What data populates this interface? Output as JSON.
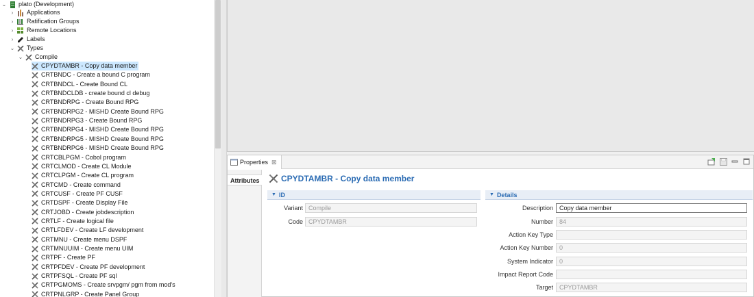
{
  "tree": {
    "root": "plato (Development)",
    "groups": [
      "Applications",
      "Ratification Groups",
      "Remote Locations",
      "Labels",
      "Types"
    ],
    "compile": "Compile",
    "items": [
      "CPYDTAMBR - Copy data member",
      "CRTBNDC - Create a bound C program",
      "CRTBNDCL - Create Bound CL",
      "CRTBNDCLDB - create bound cl debug",
      "CRTBNDRPG - Create Bound RPG",
      "CRTBNDRPG2 - MISHD Create Bound RPG",
      "CRTBNDRPG3 - Create Bound RPG",
      "CRTBNDRPG4 - MISHD Create Bound RPG",
      "CRTBNDRPG5 - MISHD Create Bound RPG",
      "CRTBNDRPG6 - MISHD Create Bound RPG",
      "CRTCBLPGM - Cobol program",
      "CRTCLMOD - Create CL Module",
      "CRTCLPGM - Create CL program",
      "CRTCMD - Create command",
      "CRTCUSF - Create PF CUSF",
      "CRTDSPF - Create Display File",
      "CRTJOBD - Create jobdescription",
      "CRTLF - Create logical file",
      "CRTLFDEV - Create LF development",
      "CRTMNU - Create menu DSPF",
      "CRTMNUUIM - Create menu UIM",
      "CRTPF - Create PF",
      "CRTPFDEV - Create PF development",
      "CRTPFSQL - Create PF sql",
      "CRTPGMOMS - Create srvpgm/ pgm from mod's",
      "CRTPNLGRP - Create Panel Group"
    ]
  },
  "properties": {
    "tab_label": "Properties",
    "tab_close": "⊠",
    "side_tab": "Attributes",
    "title": "CPYDTAMBR - Copy data member",
    "id_section": "ID",
    "details_section": "Details",
    "id_fields": [
      {
        "label": "Variant",
        "value": "Compile"
      },
      {
        "label": "Code",
        "value": "CPYDTAMBR"
      }
    ],
    "details_fields": [
      {
        "label": "Description",
        "value": "Copy data member"
      },
      {
        "label": "Number",
        "value": "84"
      },
      {
        "label": "Action Key Type",
        "value": ""
      },
      {
        "label": "Action Key Number",
        "value": "0"
      },
      {
        "label": "System Indicator",
        "value": "0"
      },
      {
        "label": "Impact Report Code",
        "value": ""
      },
      {
        "label": "Target",
        "value": "CPYDTAMBR"
      }
    ]
  },
  "colors": {
    "selection": "#cce8ff",
    "title_blue": "#2a6bb3",
    "section_bg": "#e8eef6"
  }
}
